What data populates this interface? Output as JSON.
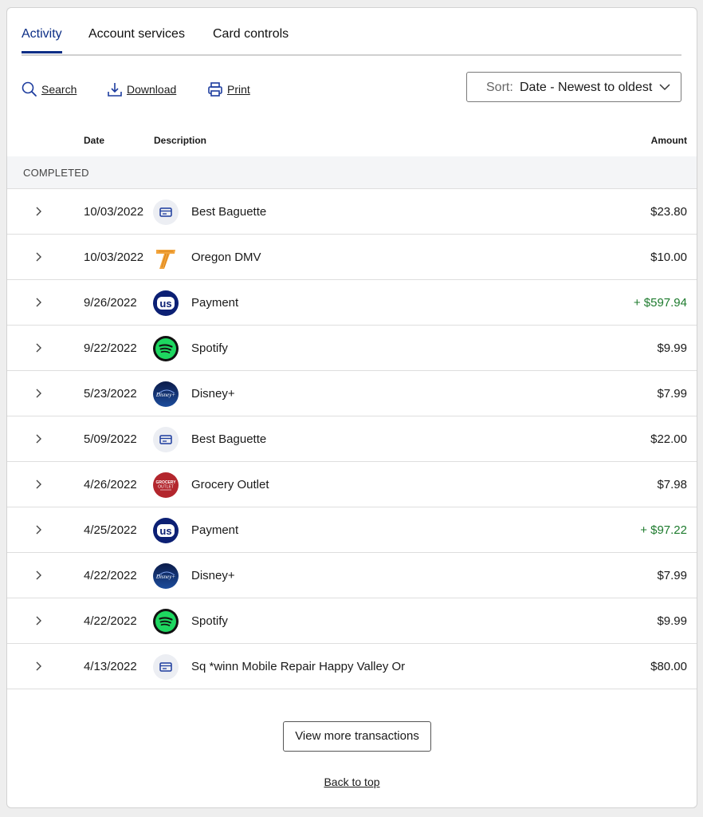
{
  "tabs": [
    {
      "label": "Activity",
      "active": true
    },
    {
      "label": "Account services",
      "active": false
    },
    {
      "label": "Card controls",
      "active": false
    }
  ],
  "toolbar": {
    "search_label": "Search",
    "download_label": "Download",
    "print_label": "Print"
  },
  "sort": {
    "label": "Sort:",
    "value": "Date - Newest to oldest"
  },
  "columns": {
    "date": "Date",
    "description": "Description",
    "amount": "Amount"
  },
  "section_label": "COMPLETED",
  "transactions": [
    {
      "date": "10/03/2022",
      "icon": "card-icon",
      "description": "Best Baguette",
      "amount": "$23.80",
      "credit": false
    },
    {
      "date": "10/03/2022",
      "icon": "oregon-dmv-logo",
      "description": "Oregon DMV",
      "amount": "$10.00",
      "credit": false
    },
    {
      "date": "9/26/2022",
      "icon": "us-bank-logo",
      "description": "Payment",
      "amount": "+ $597.94",
      "credit": true
    },
    {
      "date": "9/22/2022",
      "icon": "spotify-logo",
      "description": "Spotify",
      "amount": "$9.99",
      "credit": false
    },
    {
      "date": "5/23/2022",
      "icon": "disney-plus-logo",
      "description": "Disney+",
      "amount": "$7.99",
      "credit": false
    },
    {
      "date": "5/09/2022",
      "icon": "card-icon",
      "description": "Best Baguette",
      "amount": "$22.00",
      "credit": false
    },
    {
      "date": "4/26/2022",
      "icon": "grocery-outlet-logo",
      "description": "Grocery Outlet",
      "amount": "$7.98",
      "credit": false
    },
    {
      "date": "4/25/2022",
      "icon": "us-bank-logo",
      "description": "Payment",
      "amount": "+ $97.22",
      "credit": true
    },
    {
      "date": "4/22/2022",
      "icon": "disney-plus-logo",
      "description": "Disney+",
      "amount": "$7.99",
      "credit": false
    },
    {
      "date": "4/22/2022",
      "icon": "spotify-logo",
      "description": "Spotify",
      "amount": "$9.99",
      "credit": false
    },
    {
      "date": "4/13/2022",
      "icon": "card-icon",
      "description": "Sq *winn Mobile Repair Happy Valley Or",
      "amount": "$80.00",
      "credit": false
    }
  ],
  "view_more_label": "View more transactions",
  "back_to_top_label": "Back to top",
  "colors": {
    "accent": "#0c2e86",
    "credit": "#1e7b2e"
  }
}
